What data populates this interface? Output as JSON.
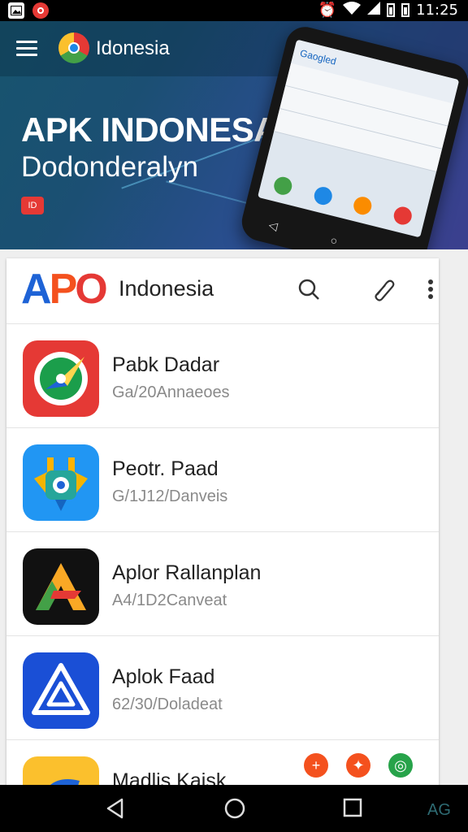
{
  "status_bar": {
    "time": "11:25"
  },
  "banner": {
    "brand": "Idonesia",
    "headline": "APK INDONESA",
    "subheadline": "Dodonderalyn",
    "badge": "ID",
    "phone_screen_title": "Gaogled"
  },
  "app_header": {
    "logo_text": "APO",
    "title": "Indonesia",
    "icons": [
      "search-icon",
      "attach-icon",
      "more-vert-icon"
    ]
  },
  "apps": [
    {
      "name": "Pabk Dadar",
      "meta": "Ga/20Annaeoes",
      "icon": "compass-app-icon",
      "color": "#e53935"
    },
    {
      "name": "Peotr. Paad",
      "meta": "G/1J12/Danveis",
      "icon": "plug-app-icon",
      "color": "#1e88e5"
    },
    {
      "name": "Aplor Rallanplan",
      "meta": "A4/1D2Canveat",
      "icon": "triangle-app-icon",
      "color": "#111111"
    },
    {
      "name": "Aplok Faad",
      "meta": "62/30/Doladeat",
      "icon": "warning-triangle-app-icon",
      "color": "#1a4fd6"
    },
    {
      "name": "Madlis Kaisk",
      "meta": "",
      "icon": "yellow-app-icon",
      "color": "#fbc02d"
    }
  ],
  "watermark": "AG",
  "colors": {
    "accent_blue": "#1e63d6",
    "orange": "#f4511e",
    "green": "#27a34a",
    "banner": "#1b4f73"
  }
}
